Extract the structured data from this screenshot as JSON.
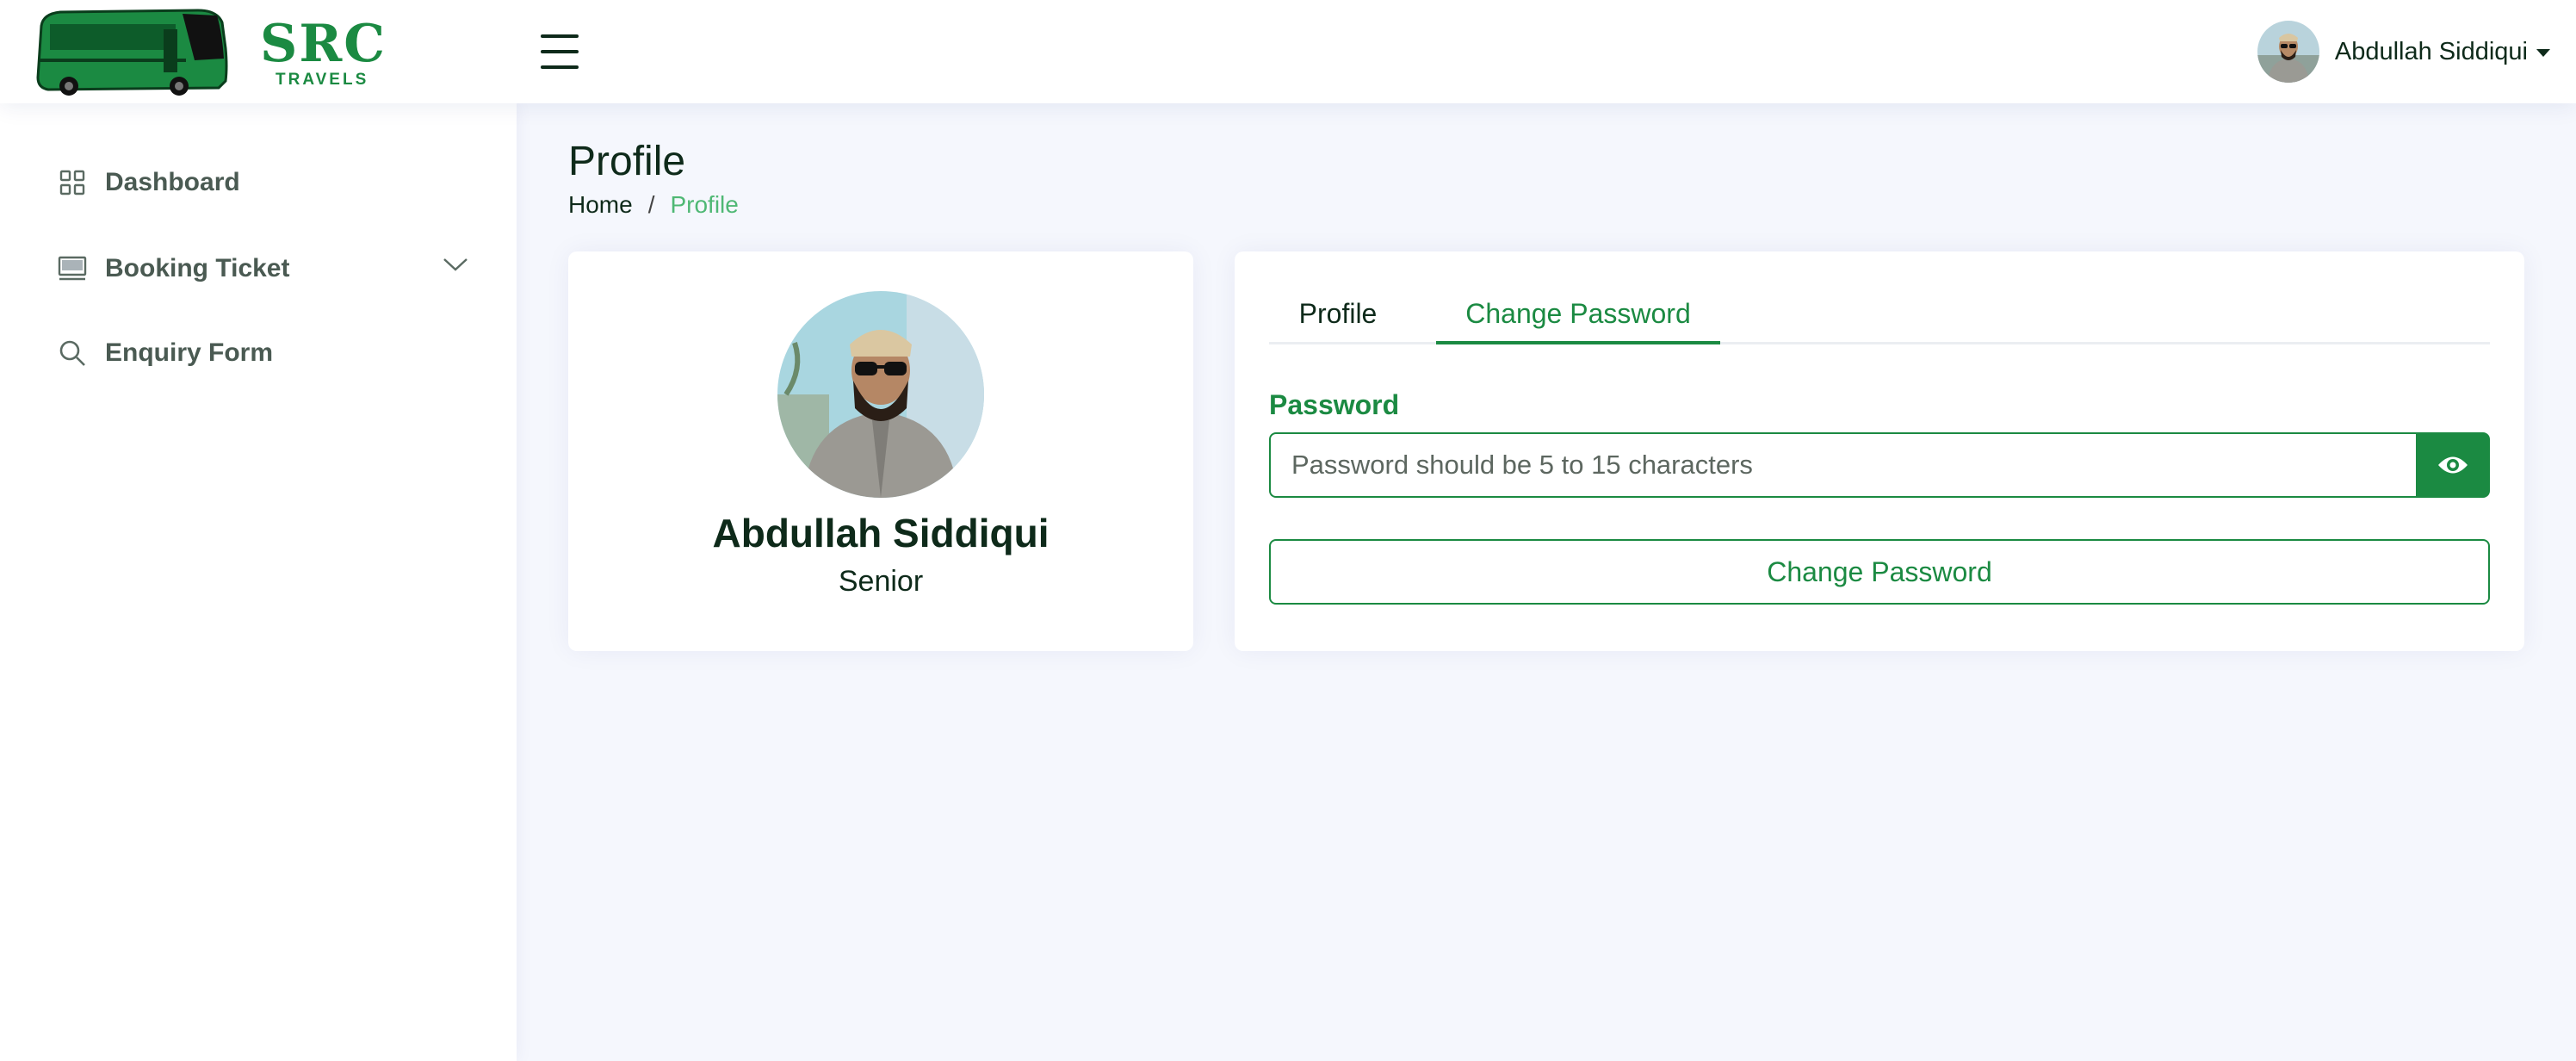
{
  "brand": {
    "name": "SRC",
    "tagline": "TRAVELS",
    "accent_color": "#1b8a42"
  },
  "header": {
    "menu_icon": "hamburger-icon",
    "user": {
      "name": "Abdullah Siddiqui",
      "dropdown_icon": "caret-down-icon"
    }
  },
  "sidebar": {
    "items": [
      {
        "label": "Dashboard",
        "icon": "grid-icon"
      },
      {
        "label": "Booking Ticket",
        "icon": "monitor-icon",
        "expand_icon": "chevron-down-icon"
      },
      {
        "label": "Enquiry Form",
        "icon": "search-icon"
      }
    ]
  },
  "page": {
    "title": "Profile",
    "breadcrumb": {
      "home": "Home",
      "separator": "/",
      "current": "Profile"
    }
  },
  "profile_card": {
    "name": "Abdullah Siddiqui",
    "role": "Senior"
  },
  "tabs": {
    "items": [
      "Profile",
      "Change Password"
    ],
    "active": "Change Password"
  },
  "change_password": {
    "label": "Password",
    "placeholder": "Password should be 5 to 15 characters",
    "value": "",
    "toggle_icon": "eye-icon",
    "submit_label": "Change Password"
  }
}
